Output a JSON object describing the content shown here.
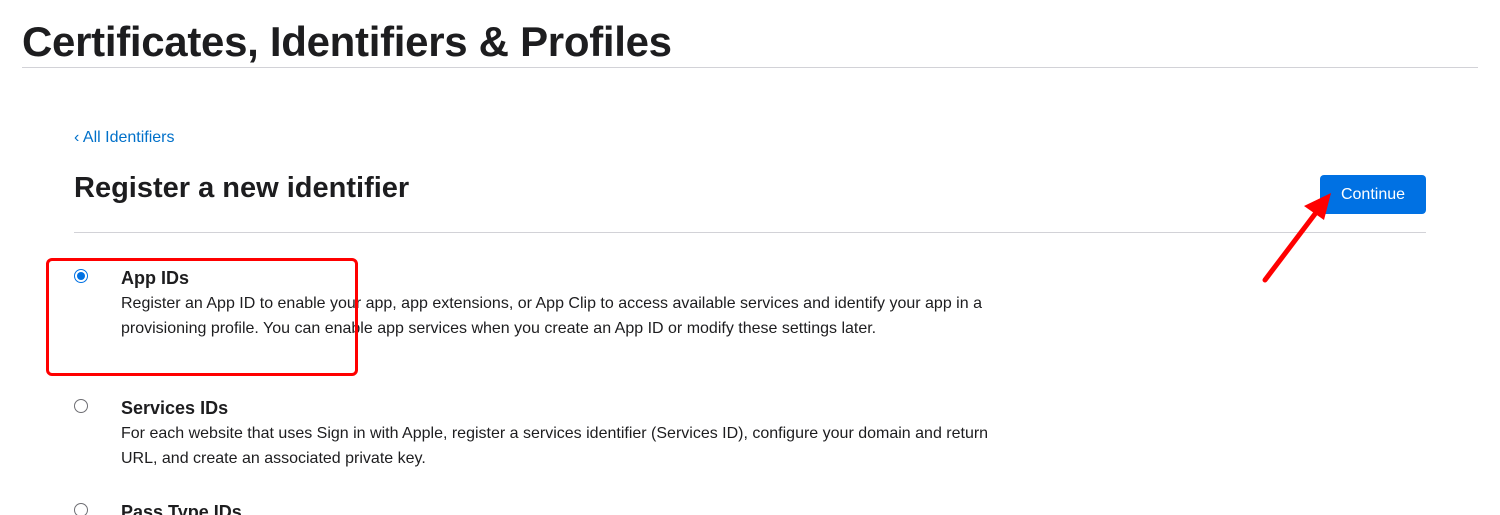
{
  "header": {
    "title": "Certificates, Identifiers & Profiles"
  },
  "breadcrumb": {
    "back_label": "‹ All Identifiers"
  },
  "main": {
    "heading": "Register a new identifier",
    "continue_label": "Continue",
    "options": [
      {
        "label": "App IDs",
        "description": "Register an App ID to enable your app, app extensions, or App Clip to access available services and identify your app in a provisioning profile. You can enable app services when you create an App ID or modify these settings later.",
        "selected": true
      },
      {
        "label": "Services IDs",
        "description": "For each website that uses Sign in with Apple, register a services identifier (Services ID), configure your domain and return URL, and create an associated private key.",
        "selected": false
      },
      {
        "label": "Pass Type IDs",
        "description": "",
        "selected": false
      }
    ]
  },
  "colors": {
    "accent": "#0071e3",
    "link": "#0070c9",
    "annotation": "#ff0000"
  }
}
